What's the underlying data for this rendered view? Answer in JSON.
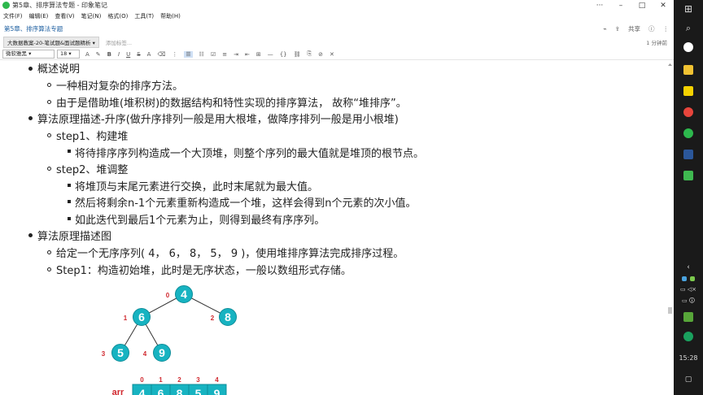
{
  "window": {
    "title": "第5章、排序算法专题 - 印象笔记",
    "minimize": "–",
    "maximize": "□",
    "close": "✕"
  },
  "menu": [
    "文件(F)",
    "编辑(E)",
    "查看(V)",
    "笔记(N)",
    "格式(O)",
    "工具(T)",
    "帮助(H)"
  ],
  "note": {
    "title": "第5章、排序算法专题",
    "share": "共享",
    "notebook": "大数据教案-20-笔试题&面试题精析",
    "add_tag": "添加标签...",
    "time": "1 分钟前"
  },
  "toolbar": {
    "font": "微软雅黑",
    "size": "18",
    "buttons": [
      "B",
      "I",
      "U",
      "S",
      "A",
      "≡",
      "≡",
      "≡",
      "≡",
      "≡",
      "⊞",
      "—",
      "🔗",
      "⊘",
      "✕"
    ]
  },
  "content": {
    "l1": "概述说明",
    "l1a": "一种相对复杂的排序方法。",
    "l1b": "由于是借助堆(堆积树)的数据结构和特性实现的排序算法， 故称“堆排序”。",
    "l2": "算法原理描述-升序(做升序排列一般是用大根堆，做降序排列一般是用小根堆)",
    "l2a": "step1、构建堆",
    "l2a1": "将待排序序列构造成一个大顶堆，则整个序列的最大值就是堆顶的根节点。",
    "l2b": "step2、堆调整",
    "l2b1": "将堆顶与末尾元素进行交换，此时末尾就为最大值。",
    "l2b2": "然后将剩余n-1个元素重新构造成一个堆，这样会得到n个元素的次小值。",
    "l2b3": "如此迭代到最后1个元素为止，则得到最终有序序列。",
    "l3": "算法原理描述图",
    "l3a": "给定一个无序序列( 4， 6， 8， 5， 9 )，使用堆排序算法完成排序过程。",
    "l3b": "Step1：构造初始堆，此时是无序状态，一般以数组形式存储。"
  },
  "diagram": {
    "nodes": [
      {
        "value": "4",
        "index": "0"
      },
      {
        "value": "6",
        "index": "1"
      },
      {
        "value": "8",
        "index": "2"
      },
      {
        "value": "5",
        "index": "3"
      },
      {
        "value": "9",
        "index": "4"
      }
    ],
    "array_label": "arr",
    "array_indices": [
      "0",
      "1",
      "2",
      "3",
      "4"
    ],
    "array_values": [
      "4",
      "6",
      "8",
      "5",
      "9"
    ],
    "node_color": "#17b3c1",
    "index_color": "#d0292f"
  },
  "taskbar": {
    "time": "15:28"
  }
}
